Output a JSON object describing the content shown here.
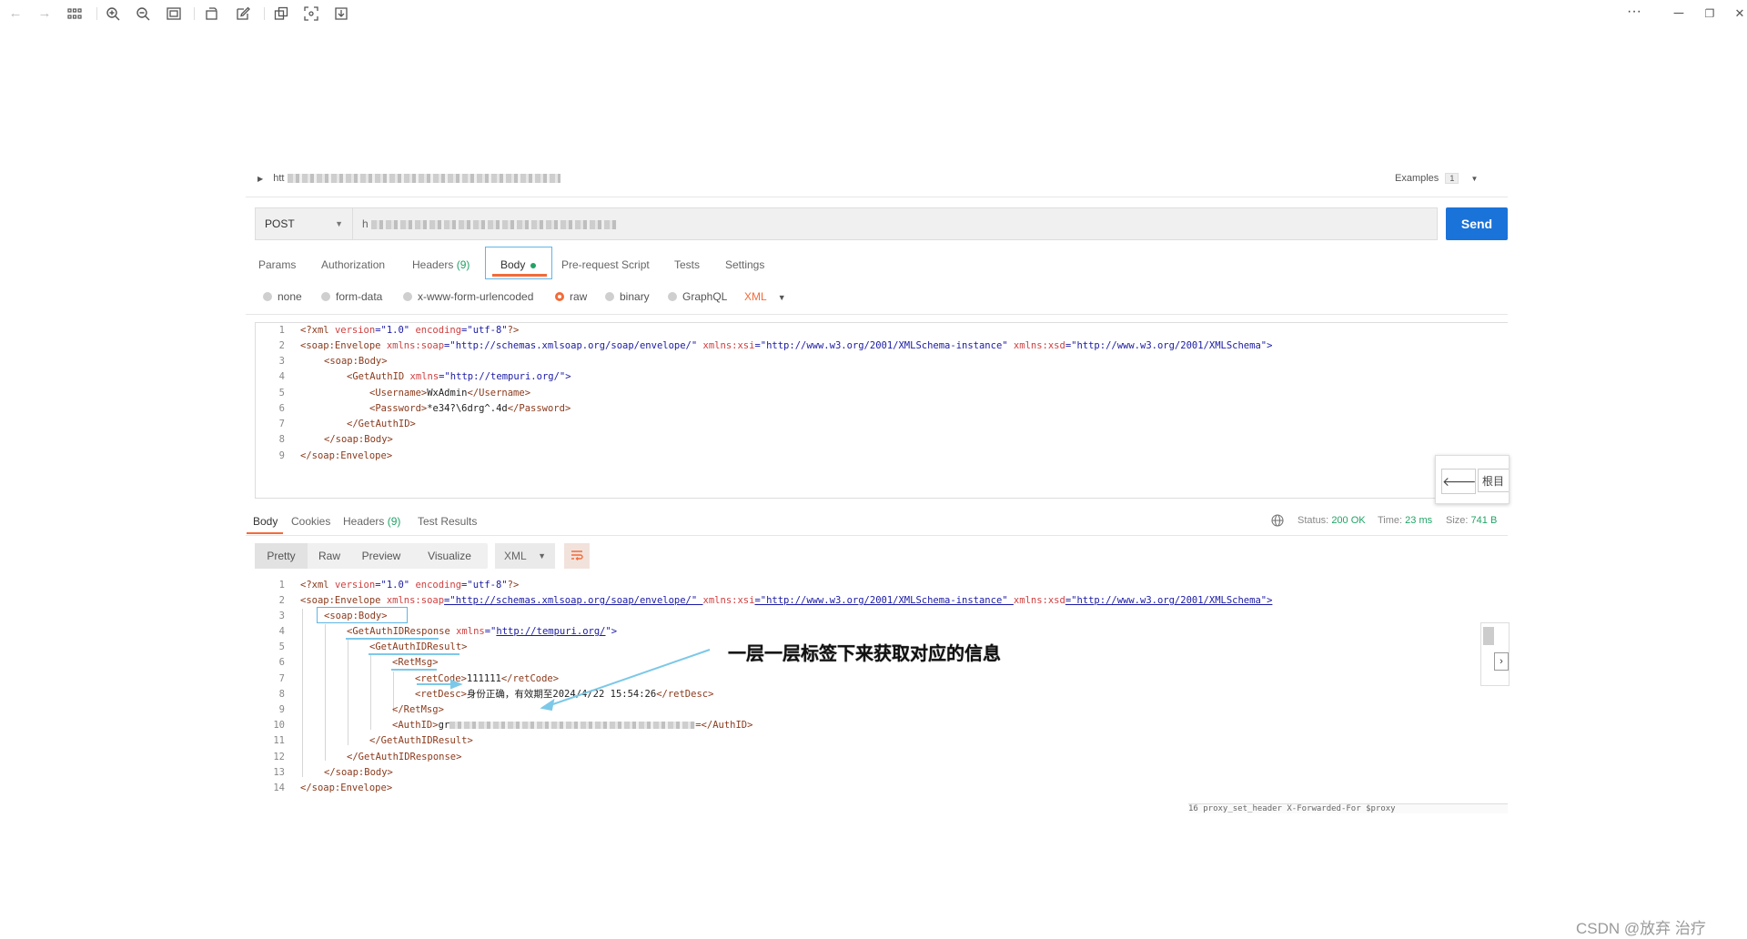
{
  "toolbar": {
    "icons": [
      "back-icon",
      "forward-icon",
      "grid-icon",
      "zoom-in-icon",
      "zoom-out-icon",
      "fit-icon",
      "rotate-icon",
      "edit-icon",
      "copy-icon",
      "crop-icon",
      "save-icon"
    ],
    "more": "···",
    "window": {
      "minimize": "─",
      "restore": "❐",
      "close": "✕"
    }
  },
  "request": {
    "collapse_label": "htt",
    "examples_label": "Examples",
    "examples_count": "1",
    "method": "POST",
    "url_prefix": "h",
    "send_label": "Send",
    "tabs": {
      "params": "Params",
      "authorization": "Authorization",
      "headers": "Headers",
      "headers_count": "(9)",
      "body": "Body",
      "prerequest": "Pre-request Script",
      "tests": "Tests",
      "settings": "Settings"
    },
    "body_types": {
      "none": "none",
      "form_data": "form-data",
      "urlencoded": "x-www-form-urlencoded",
      "raw": "raw",
      "binary": "binary",
      "graphql": "GraphQL",
      "format": "XML"
    },
    "line_numbers": [
      "1",
      "2",
      "3",
      "4",
      "5",
      "6",
      "7",
      "8",
      "9"
    ],
    "code": {
      "l1": [
        "<?xml ",
        "version",
        "=\"1.0\" ",
        "encoding",
        "=\"utf-8\"",
        "?>"
      ],
      "l2_tag": "<soap:Envelope ",
      "l2_a1": "xmlns:soap",
      "l2_v1": "=\"http://schemas.xmlsoap.org/soap/envelope/\" ",
      "l2_a2": "xmlns:xsi",
      "l2_v2": "=\"http://www.w3.org/2001/XMLSchema-instance\" ",
      "l2_a3": "xmlns:xsd",
      "l2_v3": "=\"http://www.w3.org/2001/XMLSchema\">",
      "l3": "<soap:Body>",
      "l4_tag": "<GetAuthID ",
      "l4_attr": "xmlns",
      "l4_val": "=\"http://tempuri.org/\">",
      "l5_open": "<Username>",
      "l5_text": "WxAdmin",
      "l5_close": "</Username>",
      "l6_open": "<Password>",
      "l6_text": "*e34?\\6drg^.4d",
      "l6_close": "</Password>",
      "l7": "</GetAuthID>",
      "l8": "</soap:Body>",
      "l9": "</soap:Envelope>"
    },
    "side_widget_text": "根目"
  },
  "response": {
    "tabs": {
      "body": "Body",
      "cookies": "Cookies",
      "headers": "Headers",
      "headers_count": "(9)",
      "test_results": "Test Results"
    },
    "status_label": "Status:",
    "status_value": "200 OK",
    "time_label": "Time:",
    "time_value": "23 ms",
    "size_label": "Size:",
    "size_value": "741 B",
    "formats": {
      "pretty": "Pretty",
      "raw": "Raw",
      "preview": "Preview",
      "visualize": "Visualize",
      "type": "XML"
    },
    "line_numbers": [
      "1",
      "2",
      "3",
      "4",
      "5",
      "6",
      "7",
      "8",
      "9",
      "10",
      "11",
      "12",
      "13",
      "14"
    ],
    "code": {
      "l3": "<soap:Body>",
      "l4_tag": "<GetAuthIDResponse ",
      "l4_attr": "xmlns",
      "l4_val1": "=\"",
      "l4_url": "http://tempuri.org/",
      "l4_val2": "\">",
      "l5": "<GetAuthIDResult>",
      "l6": "<RetMsg>",
      "l7_open": "<retCode>",
      "l7_text": "111111",
      "l7_close": "</retCode>",
      "l8_open": "<retDesc>",
      "l8_text": "身份正确，有效期至2024/4/22 15:54:26",
      "l8_close": "</retDesc>",
      "l9": "</RetMsg>",
      "l10_open": "<AuthID>",
      "l10_text": "gr",
      "l10_close": "=</AuthID>",
      "l11": "</GetAuthIDResult>",
      "l12": "</GetAuthIDResponse>",
      "l13": "</soap:Body>",
      "l14": "</soap:Envelope>"
    }
  },
  "annotation": "一层一层标签下来获取对应的信息",
  "bottom_snippet": "16         proxy_set_header X-Forwarded-For $proxy",
  "watermark": "CSDN @放弃      治疗",
  "colors": {
    "send": "#1a73d9",
    "accent": "#f26b3a",
    "ok": "#21a366",
    "annotation_arrow": "#7cc8e8"
  }
}
